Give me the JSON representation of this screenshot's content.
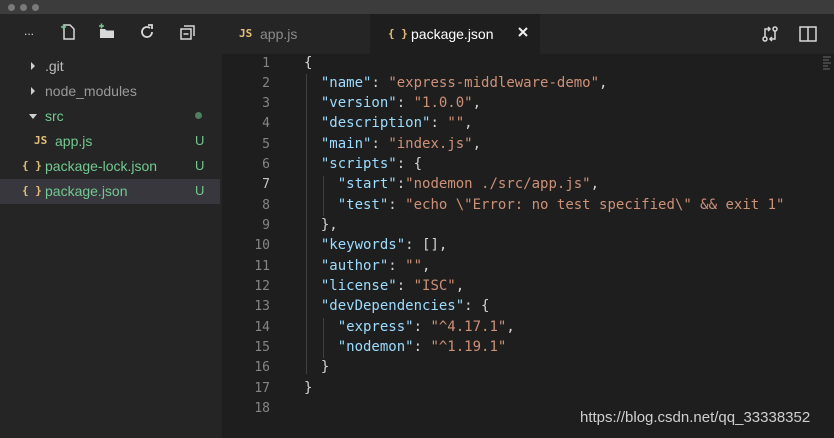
{
  "sidebar": {
    "more_label": "...",
    "items": [
      {
        "label": ".git",
        "icon": "chevron-right-icon",
        "badge": ""
      },
      {
        "label": "node_modules",
        "icon": "chevron-right-icon",
        "badge": ""
      },
      {
        "label": "src",
        "icon": "chevron-down-icon",
        "badge": ""
      },
      {
        "label": "app.js",
        "icon": "js-file-icon",
        "icon_text": "JS",
        "badge": "U"
      },
      {
        "label": "package-lock.json",
        "icon": "json-file-icon",
        "icon_text": "{ }",
        "badge": "U"
      },
      {
        "label": "package.json",
        "icon": "json-file-icon",
        "icon_text": "{ }",
        "badge": "U"
      }
    ]
  },
  "tabs": [
    {
      "label": "app.js",
      "icon_text": "JS",
      "active": false
    },
    {
      "label": "package.json",
      "icon_text": "{ }",
      "active": true
    }
  ],
  "editor": {
    "line_numbers": [
      "1",
      "2",
      "3",
      "4",
      "5",
      "6",
      "7",
      "8",
      "9",
      "10",
      "11",
      "12",
      "13",
      "14",
      "15",
      "16",
      "17",
      "18"
    ],
    "active_line": "7",
    "lines": [
      "{",
      "  \"name\": \"express-middleware-demo\",",
      "  \"version\": \"1.0.0\",",
      "  \"description\": \"\",",
      "  \"main\": \"index.js\",",
      "  \"scripts\": {",
      "    \"start\":\"nodemon ./src/app.js\",",
      "    \"test\": \"echo \\\"Error: no test specified\\\" && exit 1\"",
      "  },",
      "  \"keywords\": [],",
      "  \"author\": \"\",",
      "  \"license\": \"ISC\",",
      "  \"devDependencies\": {",
      "    \"express\": \"^4.17.1\",",
      "    \"nodemon\": \"^1.19.1\"",
      "  }",
      "}",
      ""
    ]
  },
  "watermark": "https://blog.csdn.net/qq_33338352",
  "colors": {
    "json_key": "#9cdcfe",
    "json_string": "#ce9178",
    "untracked_green": "#73c991",
    "file_icon_yellow": "#e5c07b"
  }
}
